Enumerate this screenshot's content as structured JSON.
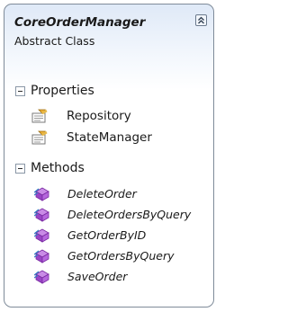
{
  "class_box": {
    "name": "CoreOrderManager",
    "kind": "Abstract Class",
    "collapse_icon": "double-chevron-up-icon"
  },
  "sections": {
    "properties": {
      "label": "Properties",
      "items": [
        "Repository",
        "StateManager"
      ],
      "icon": "property-icon"
    },
    "methods": {
      "label": "Methods",
      "items": [
        "DeleteOrder",
        "DeleteOrdersByQuery",
        "GetOrderByID",
        "GetOrdersByQuery",
        "SaveOrder"
      ],
      "icon": "abstract-method-icon"
    }
  },
  "colors": {
    "border": "#7f8b99",
    "header_gradient_top": "#dfe9f7",
    "method_icon": "#a04ec8"
  }
}
